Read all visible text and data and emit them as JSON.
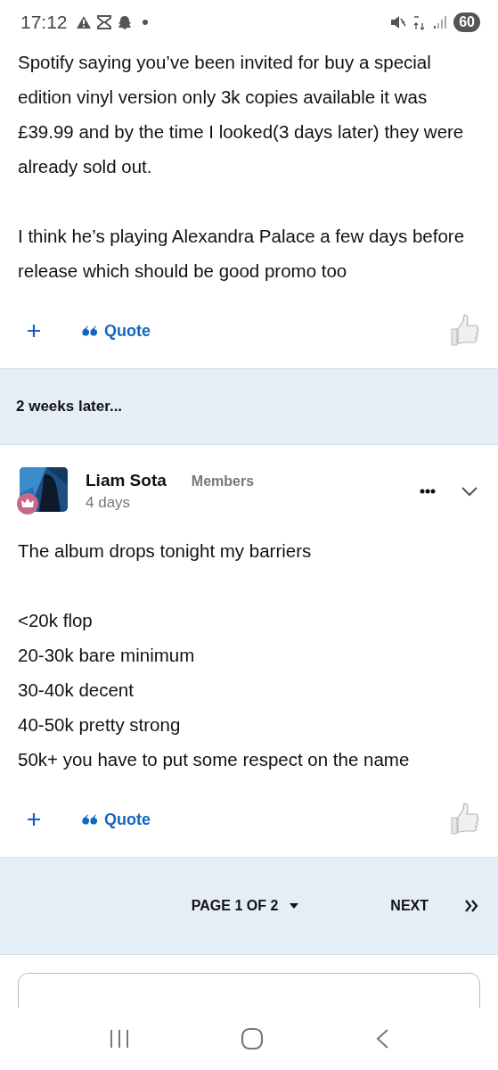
{
  "status_bar": {
    "time": "17:12",
    "battery": "60"
  },
  "posts": [
    {
      "body": [
        [
          "Spotify saying you’ve been invited for buy a special edition vinyl version only 3k copies available it was £39.99 and by the time I looked(3 days later) they were already sold out."
        ],
        [
          "I think he’s playing Alexandra Palace a few days before release which should be good promo too"
        ]
      ],
      "quote_label": "Quote"
    },
    {
      "gap_label": "2 weeks later...",
      "author": {
        "name": "Liam Sota",
        "group": "Members",
        "time": "4 days"
      },
      "body": [
        [
          "The album drops tonight my barriers"
        ],
        [
          "<20k flop",
          "20-30k bare minimum",
          "30-40k decent",
          "40-50k pretty strong",
          "50k+ you have to put some respect on the name"
        ]
      ],
      "quote_label": "Quote"
    }
  ],
  "pagination": {
    "page_label": "PAGE 1 OF 2",
    "next_label": "NEXT"
  }
}
